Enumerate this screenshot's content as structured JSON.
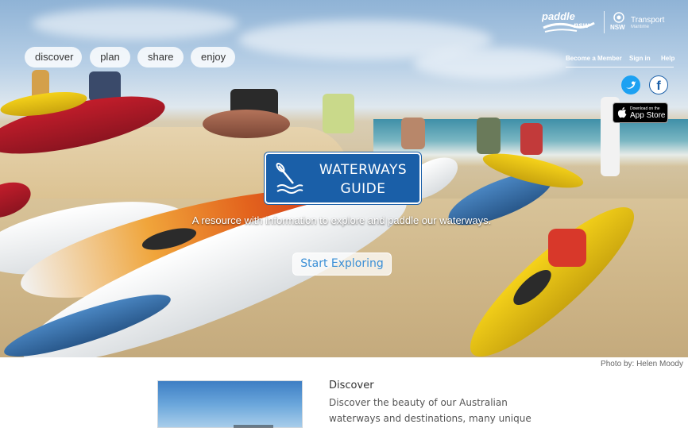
{
  "nav": {
    "items": [
      "discover",
      "plan",
      "share",
      "enjoy"
    ]
  },
  "brand": {
    "paddle_logo_text": "paddle nsw",
    "tfnsw_title": "Transport",
    "tfnsw_sub": "Maritime",
    "tfnsw_state": "NSW"
  },
  "top_links": {
    "member": "Become a Member",
    "signin": "Sign in",
    "help": "Help"
  },
  "social": {
    "twitter_icon": "twitter-icon",
    "facebook_icon": "facebook-icon"
  },
  "appstore": {
    "small": "Download on the",
    "big": "App Store"
  },
  "hero": {
    "badge_line1": "WATERWAYS",
    "badge_line2": "GUIDE",
    "tagline": "A resource with information to explore and paddle our waterways.",
    "cta": "Start Exploring",
    "credit": "Photo by: Helen Moody"
  },
  "section": {
    "title": "Discover",
    "body": "Discover the beauty of our Australian waterways and destinations, many unique"
  },
  "colors": {
    "badge_blue": "#1a5fa8",
    "cta_text": "#3a8fd6"
  }
}
